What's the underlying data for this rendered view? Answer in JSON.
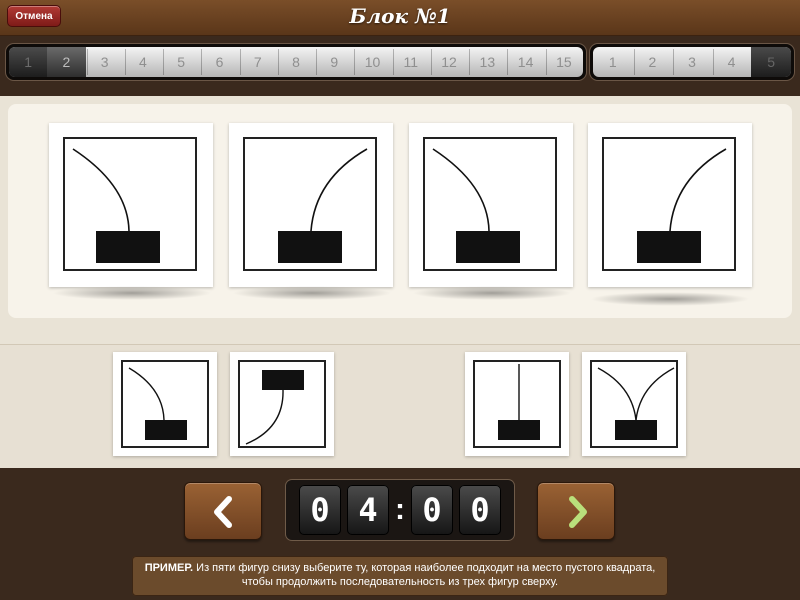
{
  "header": {
    "title": "Блок №1",
    "cancel_label": "Отмена"
  },
  "progress": {
    "main": [
      "1",
      "2",
      "3",
      "4",
      "5",
      "6",
      "7",
      "8",
      "9",
      "10",
      "11",
      "12",
      "13",
      "14",
      "15"
    ],
    "extra": [
      "1",
      "2",
      "3",
      "4",
      "5"
    ]
  },
  "timer": {
    "d1": "0",
    "d2": "4",
    "d3": "0",
    "d4": "0",
    "sep": ":"
  },
  "info": {
    "prefix": "ПРИМЕР.",
    "text": "Из пяти фигур снизу выберите ту, которая наиболее подходит на место пустого квадрата, чтобы продолжить последовательность из трех фигур сверху."
  },
  "icons": {
    "prev": "chevron-left-icon",
    "next": "chevron-right-icon"
  },
  "colors": {
    "header": "#6f4524",
    "cancel": "#a23430",
    "board": "#3a291d",
    "panel": "#f7f3ea",
    "timer": "#1b1613",
    "next_arrow": "#b9e07b"
  }
}
